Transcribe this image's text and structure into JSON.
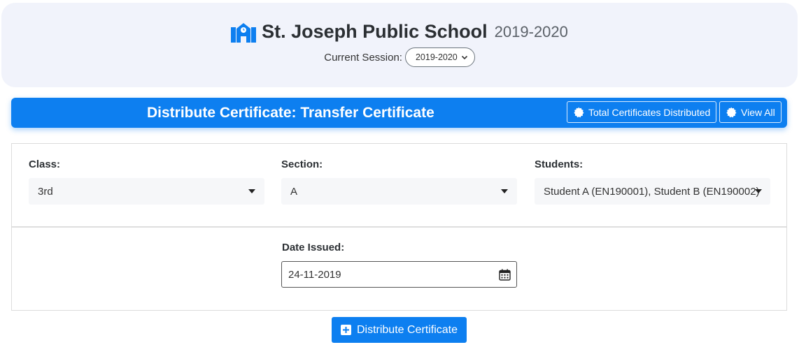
{
  "header": {
    "school_name": "St. Joseph Public School",
    "school_year": "2019-2020",
    "session_label": "Current Session:",
    "session_value": "2019-2020",
    "icon": "school-icon"
  },
  "banner": {
    "title": "Distribute Certificate: Transfer Certificate",
    "total_button": "Total Certificates Distributed",
    "view_all_button": "View All",
    "icon": "badge-icon"
  },
  "form": {
    "class_label": "Class:",
    "class_value": "3rd",
    "section_label": "Section:",
    "section_value": "A",
    "students_label": "Students:",
    "students_value": "Student A (EN190001), Student B (EN190002)",
    "date_label": "Date Issued:",
    "date_value": "24-11-2019",
    "calendar_icon": "calendar-icon"
  },
  "submit": {
    "label": "Distribute Certificate",
    "icon": "plus-square-icon"
  },
  "colors": {
    "primary": "#0d7ff0",
    "header_bg": "#f1f3fb",
    "select_bg": "#f6f7f9"
  }
}
